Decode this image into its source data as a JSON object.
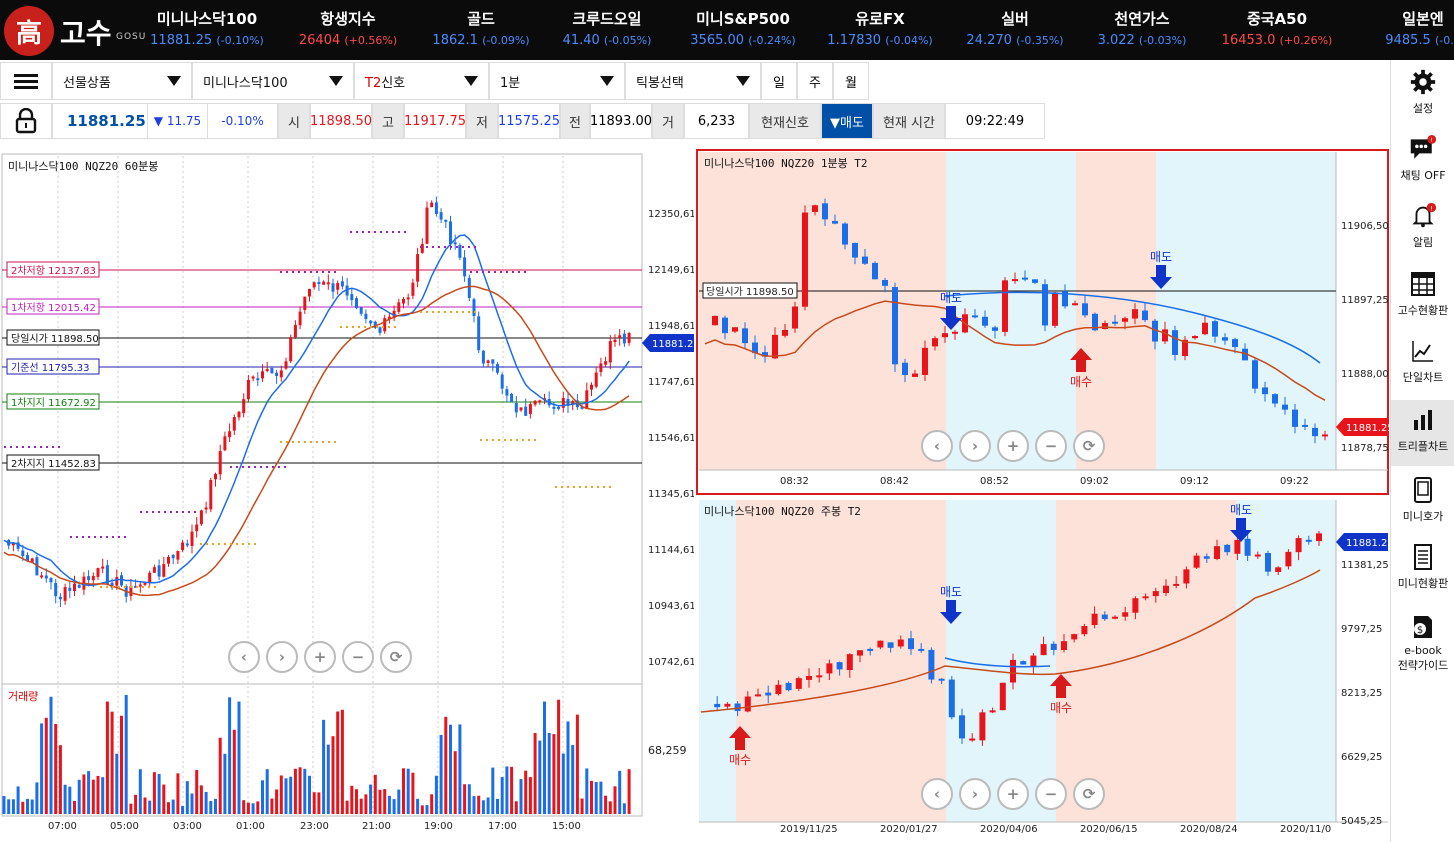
{
  "app": {
    "logo_char": "高",
    "logo_text": "고수",
    "logo_sub": "GOSU"
  },
  "tickers": [
    {
      "name": "미니나스닥100",
      "value": "11881.25",
      "change": "(-0.10%)",
      "dir": "dn"
    },
    {
      "name": "항생지수",
      "value": "26404",
      "change": "(+0.56%)",
      "dir": "up"
    },
    {
      "name": "골드",
      "value": "1862.1",
      "change": "(-0.09%)",
      "dir": "dn"
    },
    {
      "name": "크루드오일",
      "value": "41.40",
      "change": "(-0.05%)",
      "dir": "dn"
    },
    {
      "name": "미니S&P500",
      "value": "3565.00",
      "change": "(-0.24%)",
      "dir": "dn"
    },
    {
      "name": "유로FX",
      "value": "1.17830",
      "change": "(-0.04%)",
      "dir": "dn"
    },
    {
      "name": "실버",
      "value": "24.270",
      "change": "(-0.35%)",
      "dir": "dn"
    },
    {
      "name": "천연가스",
      "value": "3.022",
      "change": "(-0.03%)",
      "dir": "dn"
    },
    {
      "name": "중국A50",
      "value": "16453.0",
      "change": "(+0.26%)",
      "dir": "up"
    },
    {
      "name": "일본엔",
      "value": "9485.5",
      "change": "(-0.1",
      "dir": "dn"
    }
  ],
  "toolbar": {
    "product_select": "선물상품",
    "symbol_select": "미니나스닥100",
    "signal_prefix": "T2",
    "signal_select": "신호",
    "interval_select": "1분",
    "chart_type_select": "틱봉선택",
    "period_day": "일",
    "period_week": "주",
    "period_month": "월"
  },
  "quote": {
    "price": "11881.25",
    "change": "▼ 11.75",
    "pct": "-0.10%",
    "open_label": "시",
    "open": "11898.50",
    "high_label": "고",
    "high": "11917.75",
    "low_label": "저",
    "low": "11575.25",
    "prev_label": "전",
    "prev": "11893.00",
    "vol_label": "거",
    "vol": "6,233",
    "signal_label": "현재신호",
    "signal_value": "▼매도",
    "time_label": "현재 시간",
    "time": "09:22:49"
  },
  "sidebar": [
    {
      "label": "설정",
      "icon": "gear-icon"
    },
    {
      "label": "채팅 OFF",
      "icon": "chat-icon"
    },
    {
      "label": "알림",
      "icon": "bell-icon"
    },
    {
      "label": "고수현황판",
      "icon": "grid-icon"
    },
    {
      "label": "단일차트",
      "icon": "line-chart-icon"
    },
    {
      "label": "트리플차트",
      "icon": "bar-chart-icon"
    },
    {
      "label": "미니호가",
      "icon": "phone-icon"
    },
    {
      "label": "미니현황판",
      "icon": "document-icon"
    },
    {
      "label": "e-book",
      "label2": "전략가이드",
      "icon": "book-icon"
    }
  ],
  "chart_left": {
    "title": "미니나스닥100  NQZ20  60분봉",
    "y_ticks": [
      "12350,61",
      "12149,61",
      "11948,61",
      "11747,61",
      "11546,61",
      "11345,61",
      "11144,61",
      "10943,61",
      "10742,61"
    ],
    "x_ticks": [
      "07:00",
      "05:00",
      "03:00",
      "01:00",
      "23:00",
      "21:00",
      "19:00",
      "17:00",
      "15:00"
    ],
    "price_tag": "11881.25",
    "levels": [
      {
        "label": "2차저항 12137.83",
        "color": "#d0104f"
      },
      {
        "label": "1차저항 12015.42",
        "color": "#c020c0"
      },
      {
        "label": "당일시가 11898.50",
        "color": "#111111"
      },
      {
        "label": "기준선 11795.33",
        "color": "#2020b0"
      },
      {
        "label": "1차지지 11672.92",
        "color": "#108010"
      },
      {
        "label": "2차지지 11452.83",
        "color": "#111111"
      }
    ],
    "volume_label": "거래량",
    "volume_tick": "68,259"
  },
  "chart_right_top": {
    "title": "미니나스닥100  NQZ20  1분봉  T2",
    "y_ticks": [
      "11906,50",
      "11897,25",
      "11888,00",
      "11878,75"
    ],
    "x_ticks": [
      "08:32",
      "08:42",
      "08:52",
      "09:02",
      "09:12",
      "09:22"
    ],
    "price_tag": "11881.25",
    "open_label": "당일시가 11898.50",
    "sell_label": "매도",
    "buy_label": "매수"
  },
  "chart_right_bottom": {
    "title": "미니나스닥100  NQZ20  주봉  T2",
    "y_ticks": [
      "11381,25",
      "9797,25",
      "8213,25",
      "6629,25",
      "5045,25"
    ],
    "x_ticks": [
      "2019/11/25",
      "2020/01/27",
      "2020/04/06",
      "2020/06/15",
      "2020/08/24",
      "2020/11/0"
    ],
    "price_tag": "11881.25",
    "sell_label": "매도",
    "buy_label": "매수"
  },
  "colors": {
    "up": "#e8141c",
    "down": "#1c6ee8",
    "accent": "#0050a8"
  }
}
